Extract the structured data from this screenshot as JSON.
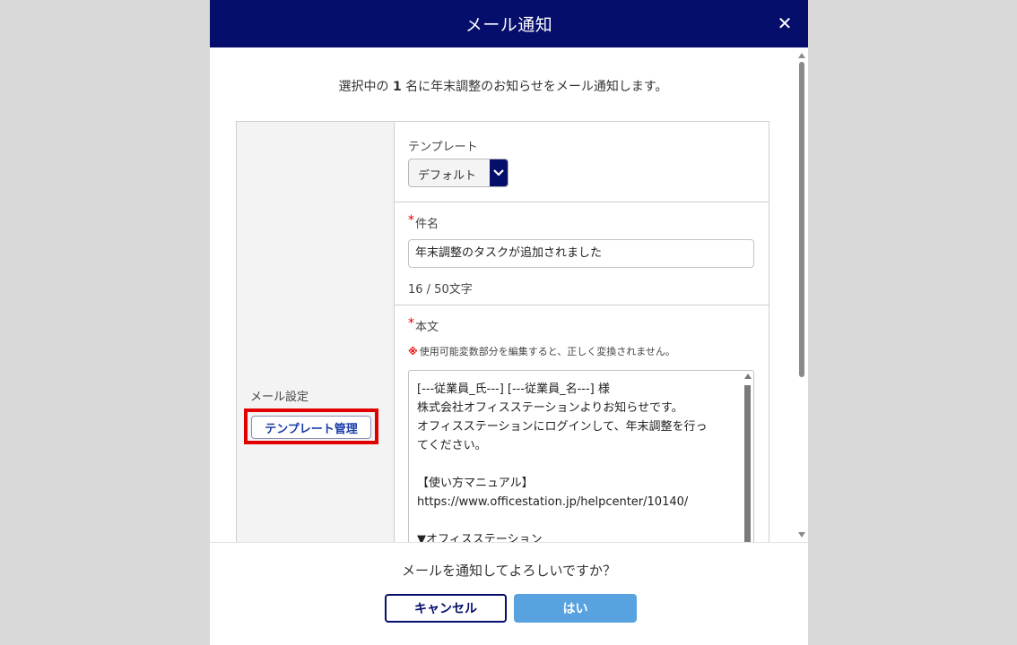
{
  "dialog": {
    "title": "メール通知",
    "close_glyph": "✕"
  },
  "intro": {
    "prefix": "選択中の ",
    "count": "1",
    "suffix": " 名に年末調整のお知らせをメール通知します。"
  },
  "settings": {
    "section_label": "メール設定",
    "template_manage_label": "テンプレート管理",
    "template": {
      "label": "テンプレート",
      "selected": "デフォルト"
    },
    "subject": {
      "required_mark": "*",
      "label": "件名",
      "value": "年末調整のタスクが追加されました",
      "char_count": "16 / 50文字"
    },
    "body": {
      "required_mark": "*",
      "label": "本文",
      "note_mark": "※",
      "note": "使用可能変数部分を編集すると、正しく変換されません。",
      "lines": [
        "[---従業員_氏---] [---従業員_名---] 様",
        "株式会社オフィスステーションよりお知らせです。",
        "オフィスステーションにログインして、年末調整を行っ",
        "てください。",
        "",
        "【使い方マニュアル】",
        "https://www.officestation.jp/helpcenter/10140/",
        "",
        "▼オフィスステーション"
      ]
    }
  },
  "footer": {
    "confirm_text": "メールを通知してよろしいですか？",
    "cancel_label": "キャンセル",
    "yes_label": "はい"
  },
  "colors": {
    "header_bg": "#050e6b",
    "primary_button": "#58a2e0",
    "highlight_border": "#e00000"
  }
}
